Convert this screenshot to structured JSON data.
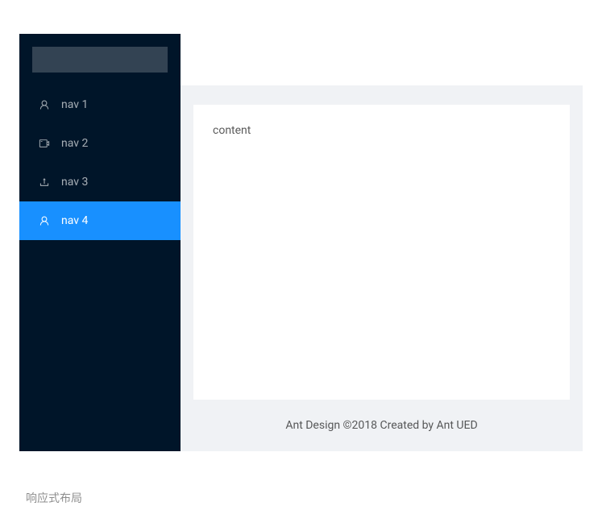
{
  "sidebar": {
    "items": [
      {
        "label": "nav 1",
        "icon": "user-icon",
        "selected": false
      },
      {
        "label": "nav 2",
        "icon": "video-camera-icon",
        "selected": false
      },
      {
        "label": "nav 3",
        "icon": "upload-icon",
        "selected": false
      },
      {
        "label": "nav 4",
        "icon": "user-icon",
        "selected": true
      }
    ]
  },
  "content": {
    "text": "content"
  },
  "footer": {
    "text": "Ant Design ©2018 Created by Ant UED"
  },
  "caption": {
    "text": "响应式布局"
  }
}
